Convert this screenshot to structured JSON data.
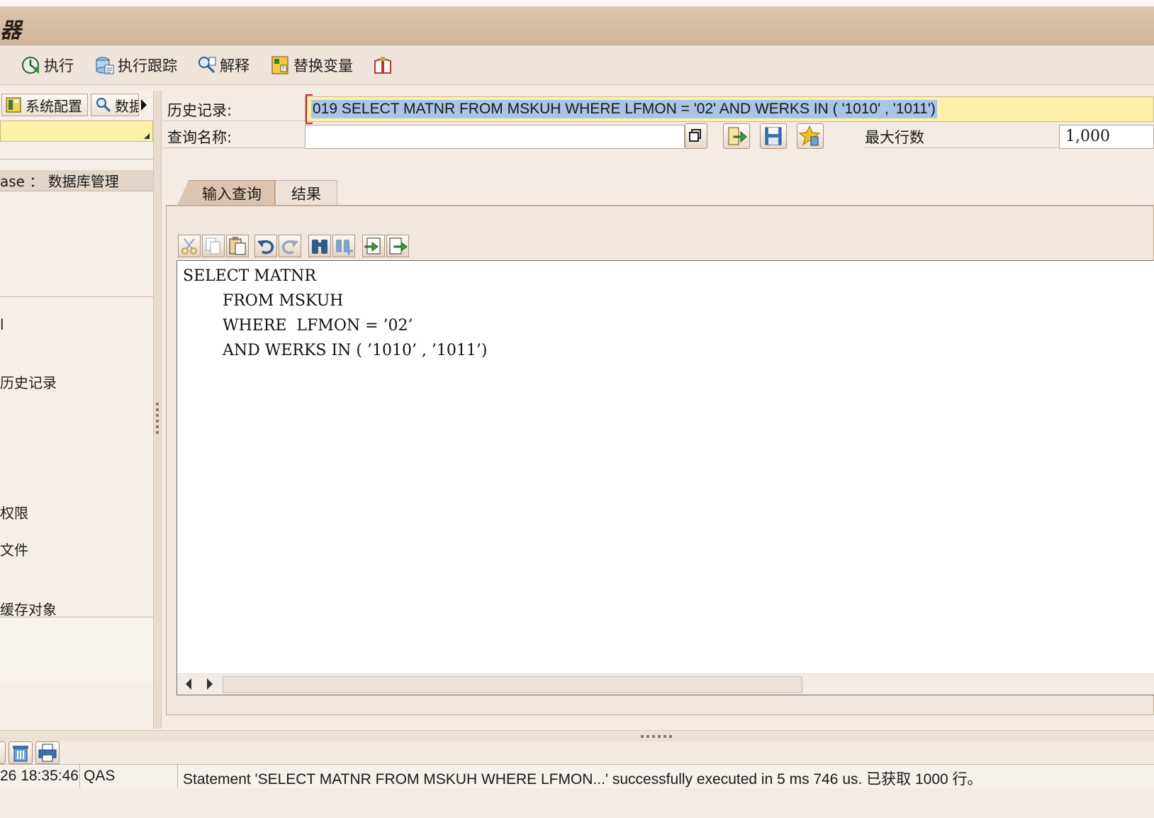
{
  "window": {
    "title": "器"
  },
  "toolbar": {
    "execute": "执行",
    "execute_trace": "执行跟踪",
    "explain": "解释",
    "replace_vars": "替换变量"
  },
  "left_panel": {
    "tabs": [
      {
        "label": "系统配置"
      },
      {
        "label": "数据"
      }
    ],
    "header": "ase ： 数据库管理",
    "items": [
      "l",
      "历史记录",
      "权限",
      "文件",
      "缓存对象"
    ]
  },
  "form": {
    "history_label": "历史记录:",
    "history_value": "019 SELECT MATNR FROM MSKUH WHERE  LFMON = '02' AND WERKS IN ( '1010' , '1011')",
    "query_name_label": "查询名称:",
    "query_name_value": "",
    "max_rows_label": "最大行数",
    "max_rows_value": "1,000"
  },
  "tabs": [
    {
      "label": "输入查询",
      "active": true
    },
    {
      "label": "结果",
      "active": false
    }
  ],
  "editor": {
    "code": "SELECT MATNR\n        FROM MSKUH\n        WHERE  LFMON = ’02’\n        AND WERKS IN ( ’1010’ , ’1011’)"
  },
  "status": {
    "datetime": "26 18:35:46",
    "system": "QAS",
    "message": "Statement 'SELECT MATNR FROM MSKUH WHERE LFMON...' successfully executed in 5 ms 746 us. 已获取 1000 行。"
  },
  "colors": {
    "title_bar": "#d2b69c",
    "history_bg": "#fdf1a8",
    "selection": "#a9c4e8",
    "tab_active": "#dcc4ae"
  }
}
